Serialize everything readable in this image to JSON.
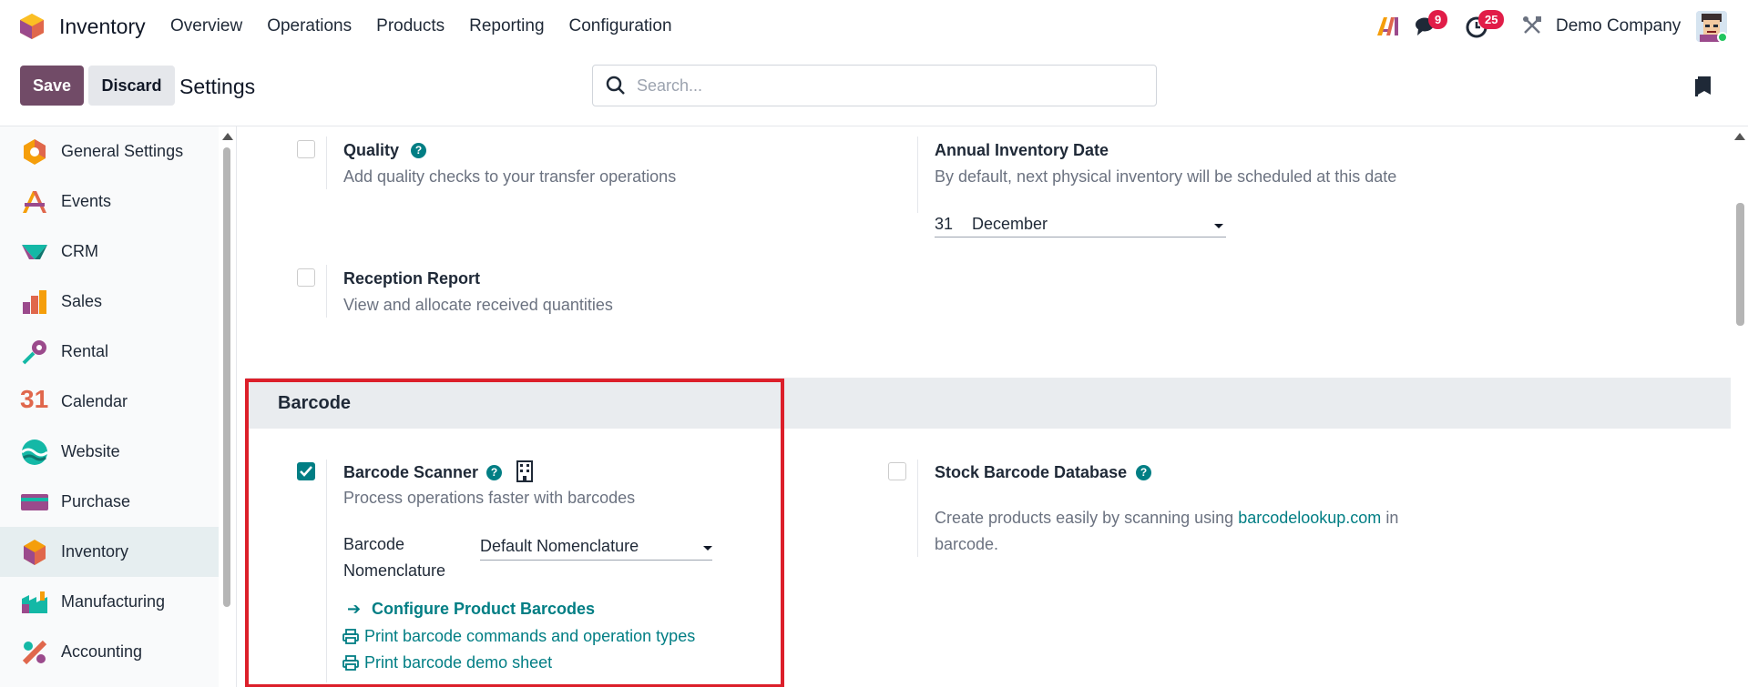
{
  "topnav": {
    "app_name": "Inventory",
    "menu": [
      "Overview",
      "Operations",
      "Products",
      "Reporting",
      "Configuration"
    ],
    "chat_count": "9",
    "activity_count": "25",
    "company": "Demo Company"
  },
  "controls": {
    "save_label": "Save",
    "discard_label": "Discard",
    "title": "Settings",
    "search_placeholder": "Search..."
  },
  "sidebar": {
    "items": [
      {
        "label": "General Settings",
        "icon": "general-settings-icon"
      },
      {
        "label": "Events",
        "icon": "events-icon"
      },
      {
        "label": "CRM",
        "icon": "crm-icon"
      },
      {
        "label": "Sales",
        "icon": "sales-icon"
      },
      {
        "label": "Rental",
        "icon": "rental-icon"
      },
      {
        "label": "Calendar",
        "icon": "calendar-icon"
      },
      {
        "label": "Website",
        "icon": "website-icon"
      },
      {
        "label": "Purchase",
        "icon": "purchase-icon"
      },
      {
        "label": "Inventory",
        "icon": "inventory-icon",
        "active": true
      },
      {
        "label": "Manufacturing",
        "icon": "manufacturing-icon"
      },
      {
        "label": "Accounting",
        "icon": "accounting-icon"
      }
    ],
    "calendar_icon_text": "31"
  },
  "settings": {
    "quality": {
      "title": "Quality",
      "desc": "Add quality checks to your transfer operations",
      "checked": false
    },
    "annual_inventory": {
      "title": "Annual Inventory Date",
      "desc": "By default, next physical inventory will be scheduled at this date",
      "day": "31",
      "month": "December"
    },
    "reception_report": {
      "title": "Reception Report",
      "desc": "View and allocate received quantities",
      "checked": false
    },
    "barcode_section": "Barcode",
    "barcode_scanner": {
      "title": "Barcode Scanner",
      "desc": "Process operations faster with barcodes",
      "checked": true,
      "nomenclature_label_1": "Barcode",
      "nomenclature_label_2": "Nomenclature",
      "nomenclature_value": "Default Nomenclature",
      "configure_link": "Configure Product Barcodes",
      "print_commands_link": "Print barcode commands and operation types",
      "print_demo_link": "Print barcode demo sheet"
    },
    "stock_barcode_db": {
      "title": "Stock Barcode Database",
      "desc_prefix": "Create products easily by scanning using",
      "desc_link": "barcodelookup.com",
      "desc_suffix": "in",
      "desc_line2": "barcode.",
      "checked": false
    }
  },
  "colors": {
    "brand": "#714b67",
    "accent": "#017e84",
    "highlight": "#dc1f2a",
    "badge": "#e11d48"
  }
}
